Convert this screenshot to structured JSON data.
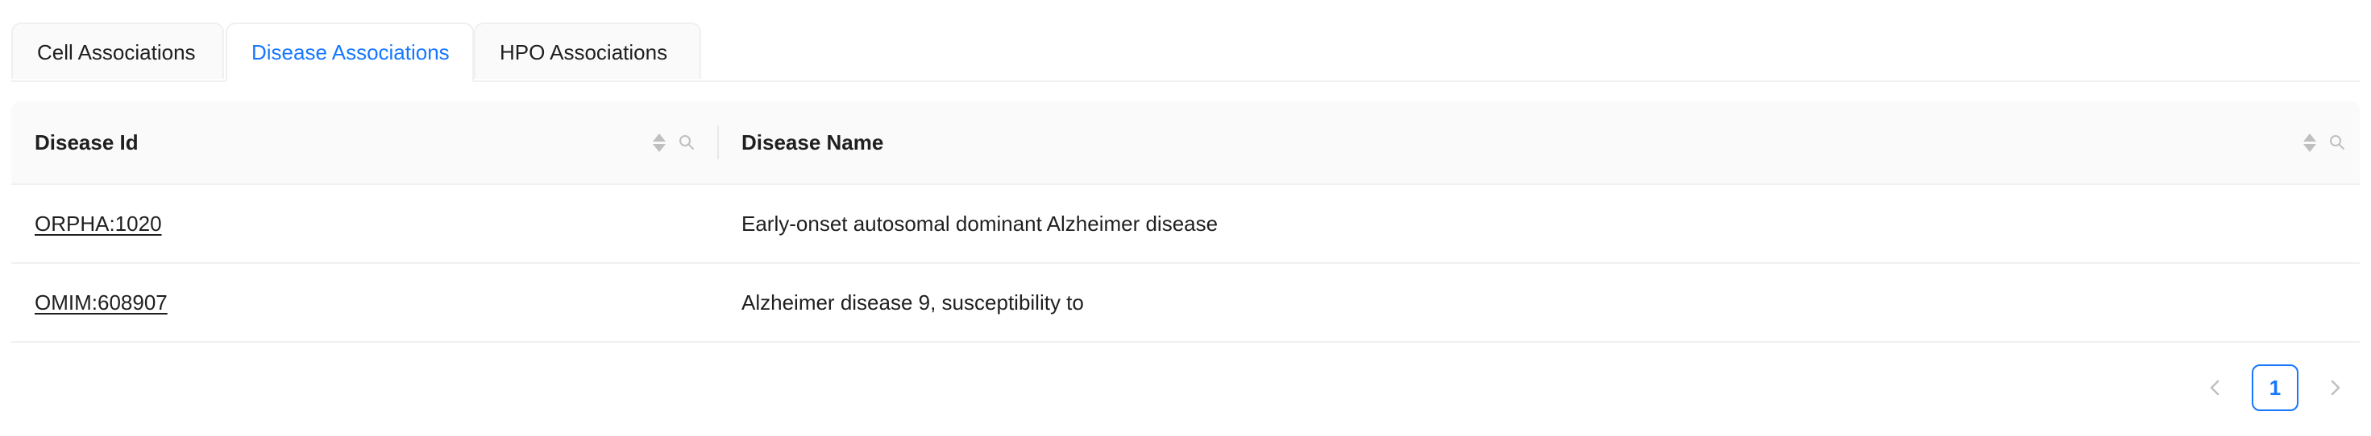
{
  "tabs": [
    {
      "label": "Cell Associations",
      "active": false
    },
    {
      "label": "Disease Associations",
      "active": true
    },
    {
      "label": "HPO Associations",
      "active": false
    }
  ],
  "table": {
    "columns": [
      {
        "label": "Disease Id"
      },
      {
        "label": "Disease Name"
      }
    ],
    "rows": [
      {
        "id": "ORPHA:1020",
        "name": "Early-onset autosomal dominant Alzheimer disease"
      },
      {
        "id": "OMIM:608907",
        "name": "Alzheimer disease 9, susceptibility to"
      }
    ]
  },
  "pagination": {
    "current_page": "1",
    "prev_icon": "chevron-left-icon",
    "next_icon": "chevron-right-icon"
  },
  "colors": {
    "accent": "#1677ff",
    "header_bg": "#fafafa",
    "border": "#f0f0f0"
  }
}
